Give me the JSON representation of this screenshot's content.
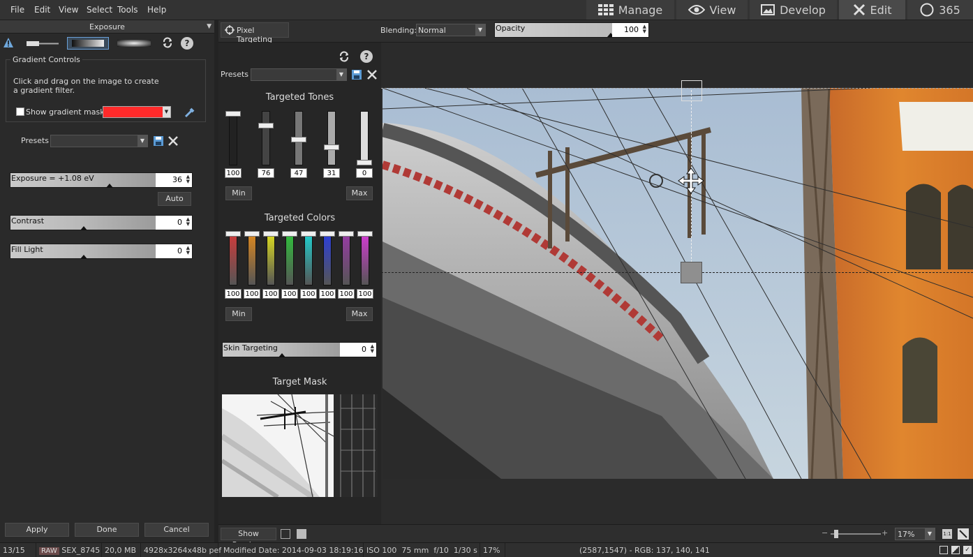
{
  "menu": [
    "File",
    "Edit",
    "View",
    "Select",
    "Tools",
    "Help"
  ],
  "modes": [
    {
      "label": "Manage",
      "icon": "grid-icon"
    },
    {
      "label": "View",
      "icon": "eye-icon"
    },
    {
      "label": "Develop",
      "icon": "image-icon"
    },
    {
      "label": "Edit",
      "icon": "tools-icon"
    },
    {
      "label": "365",
      "icon": "365-icon"
    }
  ],
  "left": {
    "header": "Exposure",
    "gradient": {
      "title": "Gradient Controls",
      "instructions": "Click and drag on the image to create a gradient filter.",
      "show_mask_label": "Show gradient mask",
      "mask_color": "#ff2a2a"
    },
    "presets_label": "Presets",
    "sliders": [
      {
        "label": "Exposure = +1.08 eV",
        "value": "36"
      },
      {
        "label": "Contrast",
        "value": "0"
      },
      {
        "label": "Fill Light",
        "value": "0"
      }
    ],
    "auto_label": "Auto",
    "buttons": {
      "apply": "Apply",
      "done": "Done",
      "cancel": "Cancel"
    }
  },
  "toolbar": {
    "pixel_targeting": "Pixel Targeting",
    "blending_label": "Blending:",
    "blending_value": "Normal",
    "opacity_label": "Opacity",
    "opacity_value": "100"
  },
  "mid": {
    "presets_label": "Presets",
    "tones_title": "Targeted Tones",
    "tones": [
      {
        "value": "100",
        "fill": 1.0,
        "color": "#222"
      },
      {
        "value": "76",
        "fill": 0.76,
        "color": "#444"
      },
      {
        "value": "47",
        "fill": 0.47,
        "color": "#777"
      },
      {
        "value": "31",
        "fill": 0.31,
        "color": "#aaa"
      },
      {
        "value": "0",
        "fill": 0.0,
        "color": "#ddd"
      }
    ],
    "min_label": "Min",
    "max_label": "Max",
    "colors_title": "Targeted Colors",
    "colors": [
      {
        "value": "100",
        "color": "#d23a3a"
      },
      {
        "value": "100",
        "color": "#e08a1e"
      },
      {
        "value": "100",
        "color": "#e2e21e"
      },
      {
        "value": "100",
        "color": "#2ec43a"
      },
      {
        "value": "100",
        "color": "#1ed4d4"
      },
      {
        "value": "100",
        "color": "#2a3ee0"
      },
      {
        "value": "100",
        "color": "#9a3aa8"
      },
      {
        "value": "100",
        "color": "#d83ad8"
      }
    ],
    "skin_label": "Skin Targeting",
    "skin_value": "0",
    "mask_title": "Target Mask"
  },
  "bottom": {
    "show_previous": "Show Previous",
    "zoom_value": "17%",
    "one_to_one": "1:1"
  },
  "status": {
    "index": "13/15",
    "raw_badge": "RAW",
    "filename": "SEX_8745",
    "size": "20,0 MB",
    "dims": "4928x3264x48b pef",
    "modified": "Modified Date: 2014-09-03 18:19:16",
    "iso": "ISO 100",
    "focal": "75 mm",
    "aperture": "f/10",
    "shutter": "1/30 s",
    "zoom": "17%",
    "coords": "(2587,1547) - RGB: 137, 140, 141"
  }
}
